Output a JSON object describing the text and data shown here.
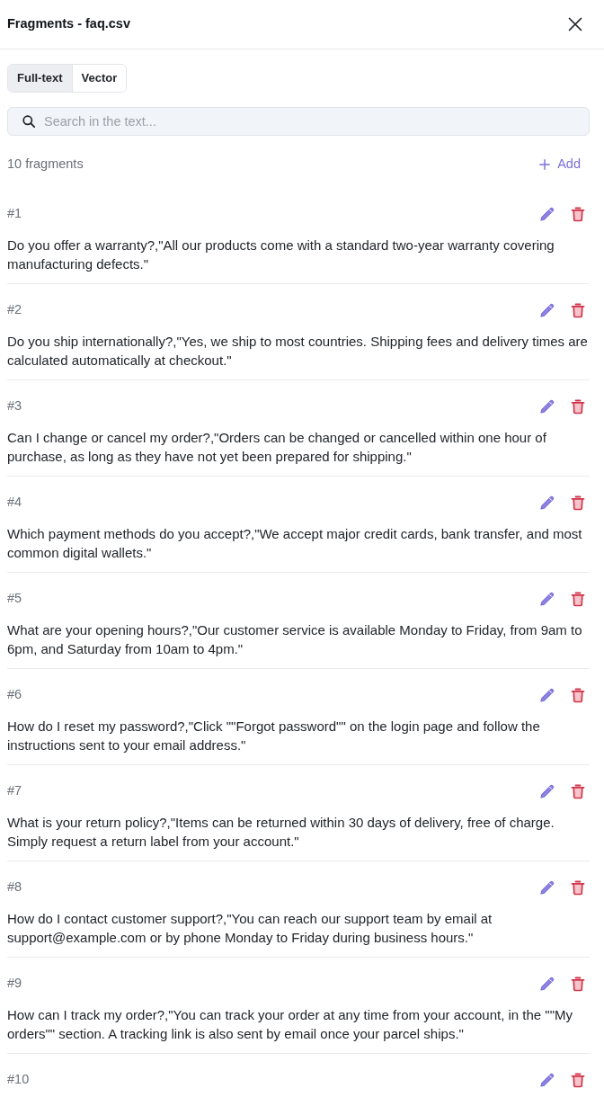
{
  "window": {
    "title": "Fragments - faq.csv"
  },
  "tabs": [
    {
      "label": "Full-text",
      "selected": true
    },
    {
      "label": "Vector",
      "selected": false
    }
  ],
  "search": {
    "placeholder": "Search in the text..."
  },
  "summary": {
    "count": "10 fragments",
    "add_label": "Add"
  },
  "fragments": [
    {
      "number": "#1",
      "text": "Do you offer a warranty?,\"All our products come with a standard two-year warranty covering manufacturing defects.\""
    },
    {
      "number": "#2",
      "text": "Do you ship internationally?,\"Yes, we ship to most countries. Shipping fees and delivery times are calculated automatically at checkout.\""
    },
    {
      "number": "#3",
      "text": "Can I change or cancel my order?,\"Orders can be changed or cancelled within one hour of purchase, as long as they have not yet been prepared for shipping.\""
    },
    {
      "number": "#4",
      "text": "Which payment methods do you accept?,\"We accept major credit cards, bank transfer, and most common digital wallets.\""
    },
    {
      "number": "#5",
      "text": "What are your opening hours?,\"Our customer service is available Monday to Friday, from 9am to 6pm, and Saturday from 10am to 4pm.\""
    },
    {
      "number": "#6",
      "text": "How do I reset my password?,\"Click \"\"Forgot password\"\" on the login page and follow the instructions sent to your email address.\""
    },
    {
      "number": "#7",
      "text": "What is your return policy?,\"Items can be returned within 30 days of delivery, free of charge. Simply request a return label from your account.\""
    },
    {
      "number": "#8",
      "text": "How do I contact customer support?,\"You can reach our support team by email at support@example.com or by phone Monday to Friday during business hours.\""
    },
    {
      "number": "#9",
      "text": "How can I track my order?,\"You can track your order at any time from your account, in the \"\"My orders\"\" section. A tracking link is also sent by email once your parcel ships.\""
    },
    {
      "number": "#10"
    }
  ]
}
